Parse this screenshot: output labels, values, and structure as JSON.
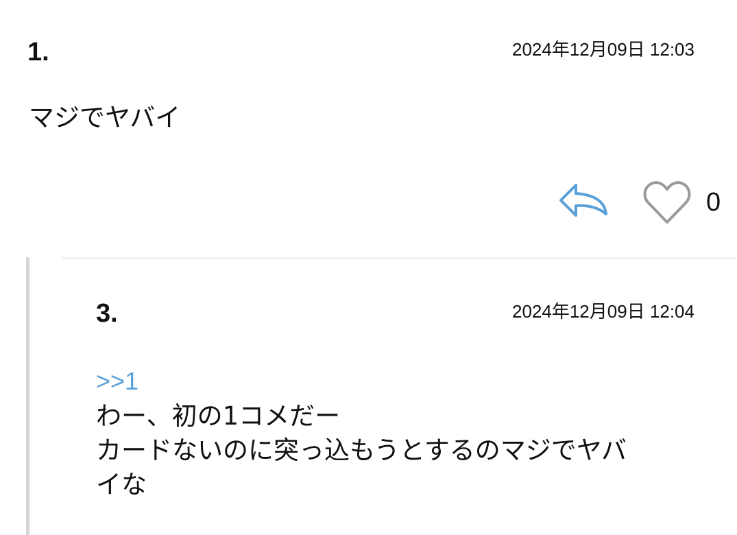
{
  "comments": [
    {
      "number": "1.",
      "date": "2024年12月09日 12:03",
      "body": "マジでヤバイ",
      "like_count": "0"
    },
    {
      "number": "3.",
      "date": "2024年12月09日 12:04",
      "anchor": ">>1",
      "body": "わー、初の1コメだー\nカードないのに突っ込もうとするのマジでヤバ\nイな"
    }
  ],
  "icons": {
    "reply": "reply-arrow-icon",
    "like": "heart-icon"
  },
  "colors": {
    "link": "#5aa0d8",
    "reply_icon": "#5aa0d8",
    "heart_outline": "#999999",
    "reply_bar": "#d6d6d6"
  }
}
